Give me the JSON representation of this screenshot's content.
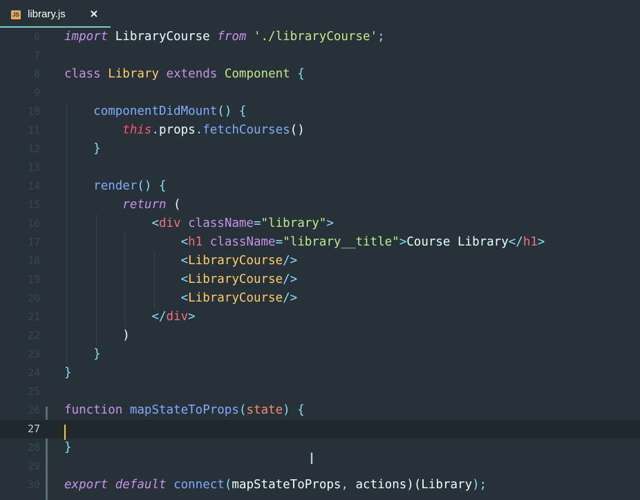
{
  "tab": {
    "file_icon": "JS",
    "title": "library.js",
    "close_icon": "×"
  },
  "colors": {
    "background": "#263238",
    "keyword": "#c792ea",
    "class_name": "#ffcb6b",
    "function": "#82aaff",
    "string": "#c3e88d",
    "punctuation": "#89ddff",
    "tag": "#f07178",
    "this": "#ff5370",
    "cursor": "#ffcc00"
  },
  "editor": {
    "current_line": "27",
    "lines": [
      {
        "n": "6",
        "tokens": [
          [
            "import",
            "kwi"
          ],
          [
            " LibraryCourse ",
            "var"
          ],
          [
            "from",
            "kwi"
          ],
          [
            " ",
            "var"
          ],
          [
            "'./libraryCourse'",
            "str"
          ],
          [
            ";",
            "pun"
          ]
        ]
      },
      {
        "n": "7",
        "tokens": []
      },
      {
        "n": "8",
        "tokens": [
          [
            "class",
            "kw"
          ],
          [
            " ",
            "var"
          ],
          [
            "Library",
            "cls"
          ],
          [
            " ",
            "var"
          ],
          [
            "extends",
            "kw"
          ],
          [
            " ",
            "var"
          ],
          [
            "Component",
            "inh"
          ],
          [
            " ",
            "var"
          ],
          [
            "{",
            "pun"
          ]
        ]
      },
      {
        "n": "9",
        "tokens": []
      },
      {
        "n": "10",
        "tokens": [
          [
            "    ",
            "var"
          ],
          [
            "componentDidMount",
            "fn"
          ],
          [
            "()",
            "pun"
          ],
          [
            " ",
            "var"
          ],
          [
            "{",
            "pun"
          ]
        ]
      },
      {
        "n": "11",
        "tokens": [
          [
            "        ",
            "var"
          ],
          [
            "this",
            "ths"
          ],
          [
            ".",
            "pun"
          ],
          [
            "props",
            "var"
          ],
          [
            ".",
            "pun"
          ],
          [
            "fetchCourses",
            "fn"
          ],
          [
            "()",
            "var"
          ]
        ]
      },
      {
        "n": "12",
        "tokens": [
          [
            "    ",
            "var"
          ],
          [
            "}",
            "pun"
          ]
        ]
      },
      {
        "n": "13",
        "tokens": []
      },
      {
        "n": "14",
        "tokens": [
          [
            "    ",
            "var"
          ],
          [
            "render",
            "fn"
          ],
          [
            "()",
            "pun"
          ],
          [
            " ",
            "var"
          ],
          [
            "{",
            "pun"
          ]
        ]
      },
      {
        "n": "15",
        "tokens": [
          [
            "        ",
            "var"
          ],
          [
            "return",
            "kwi"
          ],
          [
            " (",
            "var"
          ]
        ]
      },
      {
        "n": "16",
        "tokens": [
          [
            "            ",
            "var"
          ],
          [
            "<",
            "pun"
          ],
          [
            "div",
            "tag"
          ],
          [
            " ",
            "var"
          ],
          [
            "className",
            "attr"
          ],
          [
            "=",
            "pun"
          ],
          [
            "\"library\"",
            "str"
          ],
          [
            ">",
            "pun"
          ]
        ]
      },
      {
        "n": "17",
        "tokens": [
          [
            "                ",
            "var"
          ],
          [
            "<",
            "pun"
          ],
          [
            "h1",
            "tag"
          ],
          [
            " ",
            "var"
          ],
          [
            "className",
            "attr"
          ],
          [
            "=",
            "pun"
          ],
          [
            "\"library__title\"",
            "str"
          ],
          [
            ">",
            "pun"
          ],
          [
            "Course Library",
            "var"
          ],
          [
            "</",
            "pun"
          ],
          [
            "h1",
            "tag"
          ],
          [
            ">",
            "pun"
          ]
        ]
      },
      {
        "n": "18",
        "tokens": [
          [
            "                ",
            "var"
          ],
          [
            "<",
            "pun"
          ],
          [
            "LibraryCourse",
            "cmp"
          ],
          [
            "/>",
            "pun"
          ]
        ]
      },
      {
        "n": "19",
        "tokens": [
          [
            "                ",
            "var"
          ],
          [
            "<",
            "pun"
          ],
          [
            "LibraryCourse",
            "cmp"
          ],
          [
            "/>",
            "pun"
          ]
        ]
      },
      {
        "n": "20",
        "tokens": [
          [
            "                ",
            "var"
          ],
          [
            "<",
            "pun"
          ],
          [
            "LibraryCourse",
            "cmp"
          ],
          [
            "/>",
            "pun"
          ]
        ]
      },
      {
        "n": "21",
        "tokens": [
          [
            "            ",
            "var"
          ],
          [
            "</",
            "pun"
          ],
          [
            "div",
            "tag"
          ],
          [
            ">",
            "pun"
          ]
        ]
      },
      {
        "n": "22",
        "tokens": [
          [
            "        ",
            "var"
          ],
          [
            ")",
            "var"
          ]
        ]
      },
      {
        "n": "23",
        "tokens": [
          [
            "    ",
            "var"
          ],
          [
            "}",
            "pun"
          ]
        ]
      },
      {
        "n": "24",
        "tokens": [
          [
            "}",
            "pun"
          ]
        ]
      },
      {
        "n": "25",
        "tokens": []
      },
      {
        "n": "26",
        "tokens": [
          [
            "function",
            "kw"
          ],
          [
            " ",
            "var"
          ],
          [
            "mapStateToProps",
            "fn"
          ],
          [
            "(",
            "pun"
          ],
          [
            "state",
            "prm"
          ],
          [
            ")",
            "pun"
          ],
          [
            " ",
            "var"
          ],
          [
            "{",
            "pun"
          ]
        ]
      },
      {
        "n": "27",
        "tokens": []
      },
      {
        "n": "28",
        "tokens": [
          [
            "}",
            "pun"
          ]
        ]
      },
      {
        "n": "29",
        "tokens": []
      },
      {
        "n": "30",
        "tokens": [
          [
            "export",
            "kwi"
          ],
          [
            " ",
            "var"
          ],
          [
            "default",
            "kwi"
          ],
          [
            " ",
            "var"
          ],
          [
            "connect",
            "fn"
          ],
          [
            "(",
            "pun"
          ],
          [
            "mapStateToProps",
            "var"
          ],
          [
            ", ",
            "pun"
          ],
          [
            "actions",
            "var"
          ],
          [
            ")(",
            "var"
          ],
          [
            "Library",
            "var"
          ],
          [
            ");",
            "pun"
          ]
        ]
      }
    ]
  },
  "mouse_cursor": "I"
}
